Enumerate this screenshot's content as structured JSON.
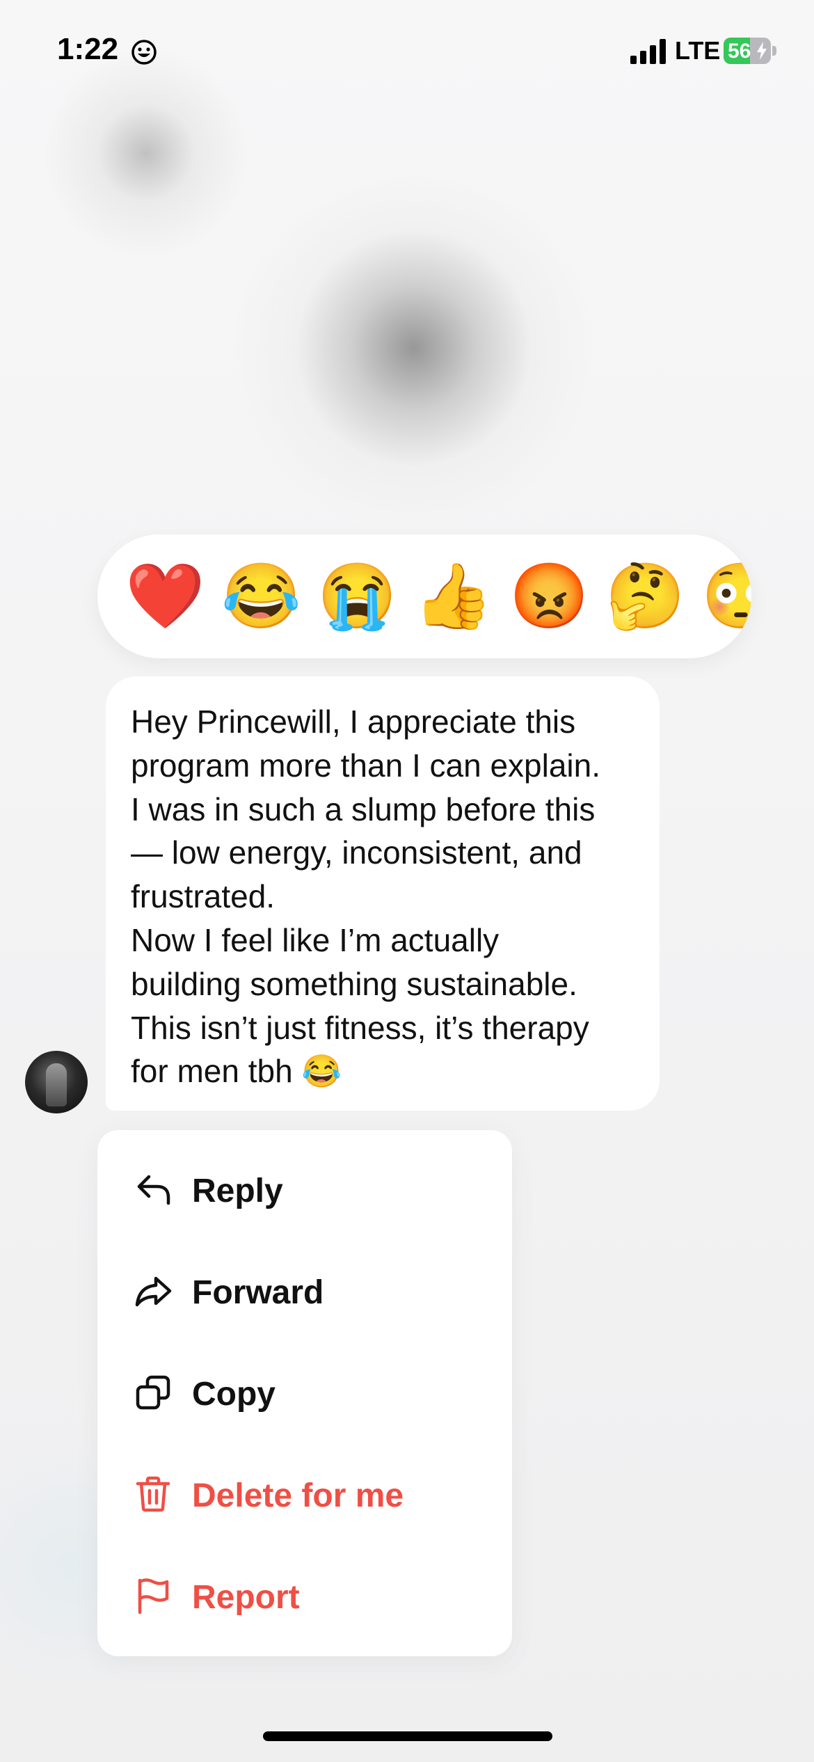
{
  "status_bar": {
    "time": "1:22",
    "carrier": "LTE",
    "battery_level": "56",
    "battery_fraction": 0.56,
    "icons": [
      "smiley-icon",
      "signal-icon",
      "battery-icon",
      "bolt-icon"
    ]
  },
  "reactions": [
    "❤️",
    "😂",
    "😭",
    "👍",
    "😡",
    "🤔",
    "😳"
  ],
  "message": {
    "lines": [
      "Hey Princewill, I appreciate this",
      "program more than I can explain.",
      "I was in such a slump before this",
      "— low energy, inconsistent, and",
      "frustrated.",
      "Now I feel like I’m actually",
      "building something sustainable.",
      "This isn’t just fitness, it’s therapy",
      "for men tbh 😂"
    ]
  },
  "menu": {
    "items": [
      {
        "label": "Reply",
        "icon": "reply-icon",
        "danger": false
      },
      {
        "label": "Forward",
        "icon": "forward-icon",
        "danger": false
      },
      {
        "label": "Copy",
        "icon": "copy-icon",
        "danger": false
      },
      {
        "label": "Delete for me",
        "icon": "trash-icon",
        "danger": true
      },
      {
        "label": "Report",
        "icon": "flag-icon",
        "danger": true
      }
    ]
  },
  "colors": {
    "danger": "#ef4f45",
    "battery_fill": "#34c759",
    "text": "#111111"
  }
}
